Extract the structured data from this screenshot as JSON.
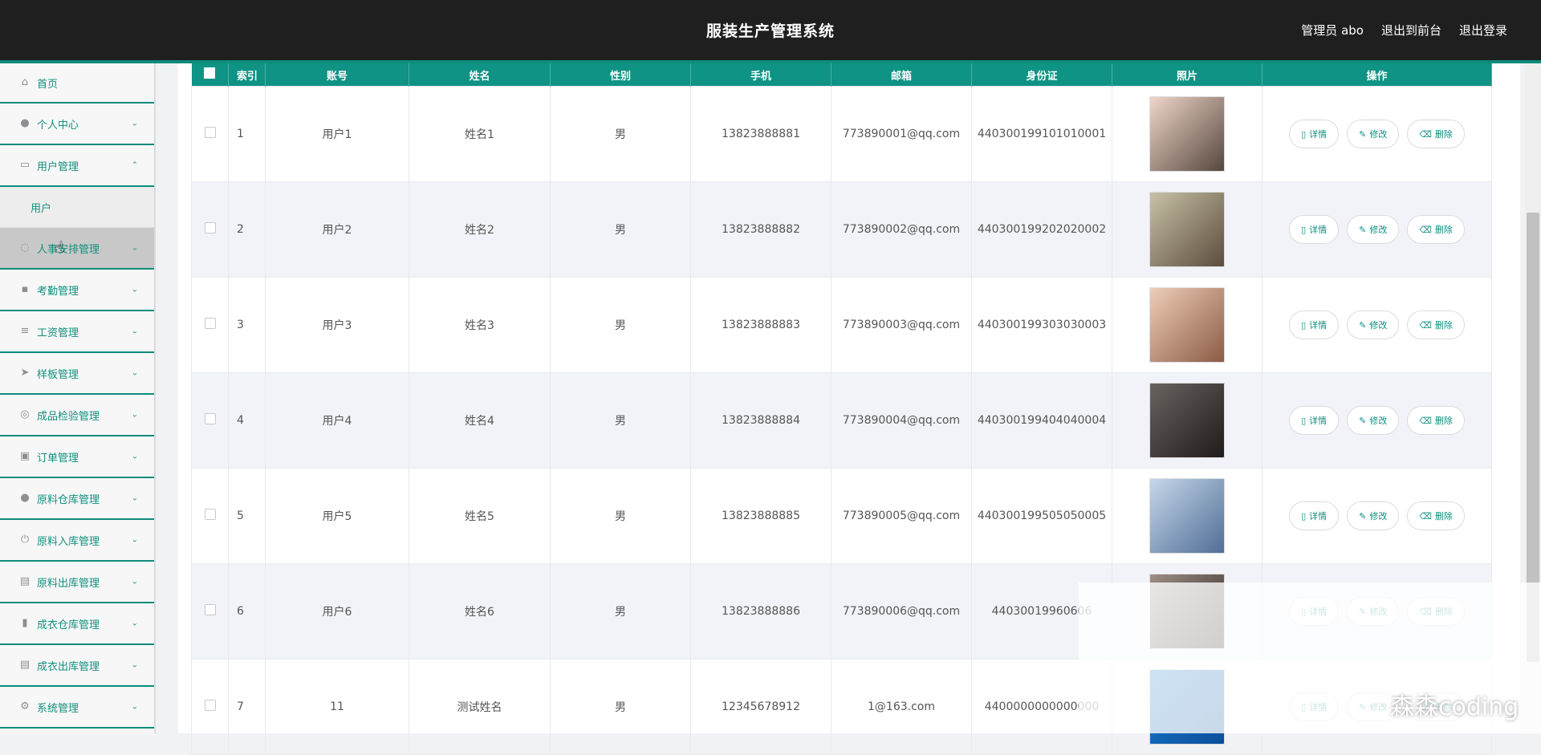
{
  "header": {
    "title": "服装生产管理系统",
    "admin_label": "管理员 abo",
    "to_front_label": "退出到前台",
    "logout_label": "退出登录"
  },
  "sidebar": {
    "items": [
      {
        "label": "首页",
        "icon": "home-icon",
        "expanded": false
      },
      {
        "label": "个人中心",
        "icon": "user-icon",
        "expanded": false
      },
      {
        "label": "用户管理",
        "icon": "user-management-icon",
        "expanded": true
      },
      {
        "label": "人事安排管理",
        "icon": "schedule-icon",
        "expanded": false
      },
      {
        "label": "考勤管理",
        "icon": "chat-icon",
        "expanded": false
      },
      {
        "label": "工资管理",
        "icon": "list-icon",
        "expanded": false
      },
      {
        "label": "样板管理",
        "icon": "send-icon",
        "expanded": false
      },
      {
        "label": "成品检验管理",
        "icon": "target-icon",
        "expanded": false
      },
      {
        "label": "订单管理",
        "icon": "print-icon",
        "expanded": false
      },
      {
        "label": "原料仓库管理",
        "icon": "person-icon",
        "expanded": false
      },
      {
        "label": "原料入库管理",
        "icon": "power-icon",
        "expanded": false
      },
      {
        "label": "原料出库管理",
        "icon": "clipboard-icon",
        "expanded": false
      },
      {
        "label": "成衣仓库管理",
        "icon": "bar-chart-icon",
        "expanded": false
      },
      {
        "label": "成衣出库管理",
        "icon": "clipboard-icon",
        "expanded": false
      },
      {
        "label": "系统管理",
        "icon": "gear-icon",
        "expanded": false
      }
    ],
    "submenu": {
      "label": "用户"
    }
  },
  "table": {
    "headers": [
      "",
      "索引",
      "账号",
      "姓名",
      "性别",
      "手机",
      "邮箱",
      "身份证",
      "照片",
      "操作"
    ],
    "rows": [
      {
        "index": "1",
        "account": "用户1",
        "name": "姓名1",
        "gender": "男",
        "phone": "13823888881",
        "email": "773890001@qq.com",
        "idcard": "440300199101010001"
      },
      {
        "index": "2",
        "account": "用户2",
        "name": "姓名2",
        "gender": "男",
        "phone": "13823888882",
        "email": "773890002@qq.com",
        "idcard": "440300199202020002"
      },
      {
        "index": "3",
        "account": "用户3",
        "name": "姓名3",
        "gender": "男",
        "phone": "13823888883",
        "email": "773890003@qq.com",
        "idcard": "440300199303030003"
      },
      {
        "index": "4",
        "account": "用户4",
        "name": "姓名4",
        "gender": "男",
        "phone": "13823888884",
        "email": "773890004@qq.com",
        "idcard": "440300199404040004"
      },
      {
        "index": "5",
        "account": "用户5",
        "name": "姓名5",
        "gender": "男",
        "phone": "13823888885",
        "email": "773890005@qq.com",
        "idcard": "440300199505050005"
      },
      {
        "index": "6",
        "account": "用户6",
        "name": "姓名6",
        "gender": "男",
        "phone": "13823888886",
        "email": "773890006@qq.com",
        "idcard": "44030019960606"
      },
      {
        "index": "7",
        "account": "11",
        "name": "测试姓名",
        "gender": "男",
        "phone": "12345678912",
        "email": "1@163.com",
        "idcard": "4400000000000000"
      }
    ],
    "action_labels": {
      "detail": "详情",
      "edit": "修改",
      "delete": "删除"
    }
  },
  "watermark": "森森coding"
}
